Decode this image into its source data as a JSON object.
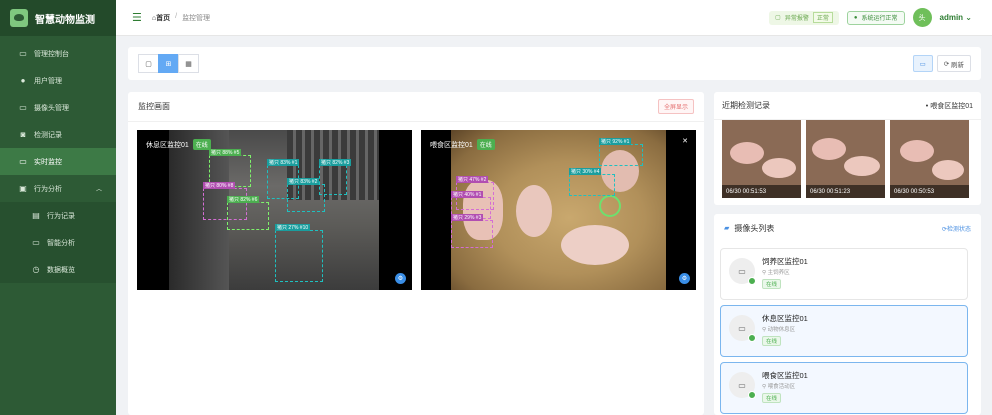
{
  "app": {
    "title": "智慧动物监测"
  },
  "sidebar": {
    "items": [
      {
        "icon": "monitor-icon",
        "label": "管理控制台"
      },
      {
        "icon": "user-icon",
        "label": "用户管理"
      },
      {
        "icon": "camera-icon",
        "label": "摄像头管理"
      },
      {
        "icon": "record-icon",
        "label": "检测记录"
      },
      {
        "icon": "live-icon",
        "label": "实时监控"
      },
      {
        "icon": "chart-icon",
        "label": "行为分析"
      },
      {
        "icon": "doc-icon",
        "label": "行为记录"
      },
      {
        "icon": "analysis-icon",
        "label": "智能分析"
      },
      {
        "icon": "clock-icon",
        "label": "数据概览"
      }
    ]
  },
  "header": {
    "breadcrumb": {
      "home": "首页",
      "current": "监控管理"
    },
    "alert_label": "异常报警",
    "alert_tag": "正常",
    "system_status": "系统运行正常",
    "avatar_text": "头",
    "user": "admin"
  },
  "toolbar": {
    "view_buttons": [
      "▢",
      "⊞",
      "▦"
    ],
    "snapshot": "▭",
    "refresh": "刷新"
  },
  "main": {
    "title": "监控画面",
    "fullscreen": "全屏显示",
    "cameras": [
      {
        "name": "休息区监控01",
        "status": "在线",
        "boxes": [
          {
            "label": "猪只 88% #5"
          },
          {
            "label": "猪只 83% #1"
          },
          {
            "label": "猪只 82% #3"
          },
          {
            "label": "猪只 83% #2"
          },
          {
            "label": "猪只 80% #8"
          },
          {
            "label": "猪只 82% #6"
          },
          {
            "label": "猪只 27% #10"
          }
        ]
      },
      {
        "name": "喂食区监控01",
        "status": "在线",
        "boxes": [
          {
            "label": "猪只 92% #1"
          },
          {
            "label": "猪只 30% #4"
          },
          {
            "label": "猪只 47% #2"
          },
          {
            "label": "猪只 40% #1"
          },
          {
            "label": "猪只 29% #3"
          }
        ]
      }
    ]
  },
  "recent": {
    "title": "近期检测记录",
    "camera": "喂食区监控01",
    "thumbs": [
      {
        "time": "06/30 00:51:53"
      },
      {
        "time": "06/30 00:51:23"
      },
      {
        "time": "06/30 00:50:53"
      }
    ]
  },
  "camlist": {
    "title": "摄像头列表",
    "refresh": "检测状态",
    "items": [
      {
        "name": "饲养区监控01",
        "location": "主饲养区",
        "status": "在线"
      },
      {
        "name": "休息区监控01",
        "location": "动物休息区",
        "status": "在线"
      },
      {
        "name": "喂食区监控01",
        "location": "喂食活动区",
        "status": "在线"
      }
    ]
  },
  "colors": {
    "sidebar": "#2d5a35",
    "accent": "#4caf50",
    "active": "#3d7a46",
    "primary": "#63a9f4"
  }
}
